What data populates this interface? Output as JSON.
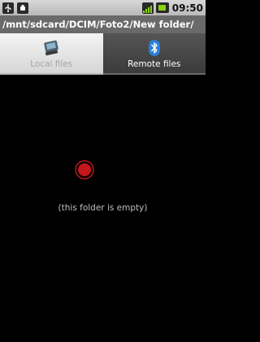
{
  "status_bar": {
    "notification_icons": [
      "usb-icon",
      "android-debug-icon"
    ],
    "signal_icon": "signal-icon",
    "battery_icon": "battery-icon",
    "time": "09:50"
  },
  "path_bar": {
    "path": "/mnt/sdcard/DCIM/Foto2/New folder/"
  },
  "tabs": [
    {
      "label": "Local files",
      "icon": "device-icon",
      "selected": false
    },
    {
      "label": "Remote files",
      "icon": "bluetooth-icon",
      "selected": true
    }
  ],
  "content": {
    "empty_message": "(this folder is empty)",
    "indicator_icon": "record-icon",
    "indicator_color": "#c4161c"
  },
  "colors": {
    "status_bar_bg": "#c9c9c9",
    "path_bar_bg": "#6a6a6a",
    "tab_selected_bg": "#474747",
    "tab_unselected_bg": "#e6e6e6",
    "accent_green": "#8bd10e",
    "bluetooth_blue": "#2a7fd6"
  }
}
